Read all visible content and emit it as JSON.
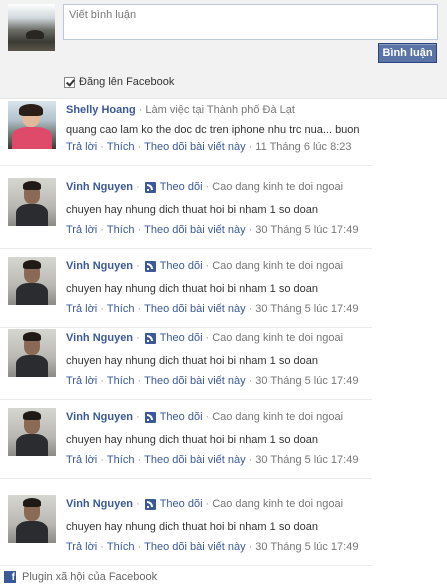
{
  "composer": {
    "placeholder": "Viết bình luận",
    "post_label": "Bình luận",
    "share_label": "Đăng lên Facebook",
    "share_checked": true
  },
  "comments": [
    {
      "author": "Shelly Hoang",
      "meta": "Làm việc tại Thành phố Đà Lạt",
      "follow": "",
      "body": "quang cao lam ko the doc dc tren iphone nhu trc nua... buon",
      "reply": "Trả lời",
      "like": "Thích",
      "follow_post": "Theo dõi bài viết này",
      "time": "11 Tháng 6 lúc 8:23"
    },
    {
      "author": "Vinh Nguyen",
      "follow": "Theo dõi",
      "meta": "Cao dang kinh te doi ngoai",
      "body": "chuyen hay nhung dich thuat hoi bi nham 1 so doan",
      "reply": "Trả lời",
      "like": "Thích",
      "follow_post": "Theo dõi bài viết này",
      "time": "30 Tháng 5 lúc 17:49"
    },
    {
      "author": "Vinh Nguyen",
      "follow": "Theo dõi",
      "meta": "Cao dang kinh te doi ngoai",
      "body": "chuyen hay nhung dich thuat hoi bi nham 1 so doan",
      "reply": "Trả lời",
      "like": "Thích",
      "follow_post": "Theo dõi bài viết này",
      "time": "30 Tháng 5 lúc 17:49"
    },
    {
      "author": "Vinh Nguyen",
      "follow": "Theo dõi",
      "meta": "Cao dang kinh te doi ngoai",
      "body": "chuyen hay nhung dich thuat hoi bi nham 1 so doan",
      "reply": "Trả lời",
      "like": "Thích",
      "follow_post": "Theo dõi bài viết này",
      "time": "30 Tháng 5 lúc 17:49"
    },
    {
      "author": "Vinh Nguyen",
      "follow": "Theo dõi",
      "meta": "Cao dang kinh te doi ngoai",
      "body": "chuyen hay nhung dich thuat hoi bi nham 1 so doan",
      "reply": "Trả lời",
      "like": "Thích",
      "follow_post": "Theo dõi bài viết này",
      "time": "30 Tháng 5 lúc 17:49"
    },
    {
      "author": "Vinh Nguyen",
      "follow": "Theo dõi",
      "meta": "Cao dang kinh te doi ngoai",
      "body": "chuyen hay nhung dich thuat hoi bi nham 1 so doan",
      "reply": "Trả lời",
      "like": "Thích",
      "follow_post": "Theo dõi bài viết này",
      "time": "30 Tháng 5 lúc 17:49"
    }
  ],
  "footer": {
    "text": "Plugin xã hội của Facebook"
  },
  "colors": {
    "link": "#3b5998",
    "button": "#5b74a8"
  }
}
